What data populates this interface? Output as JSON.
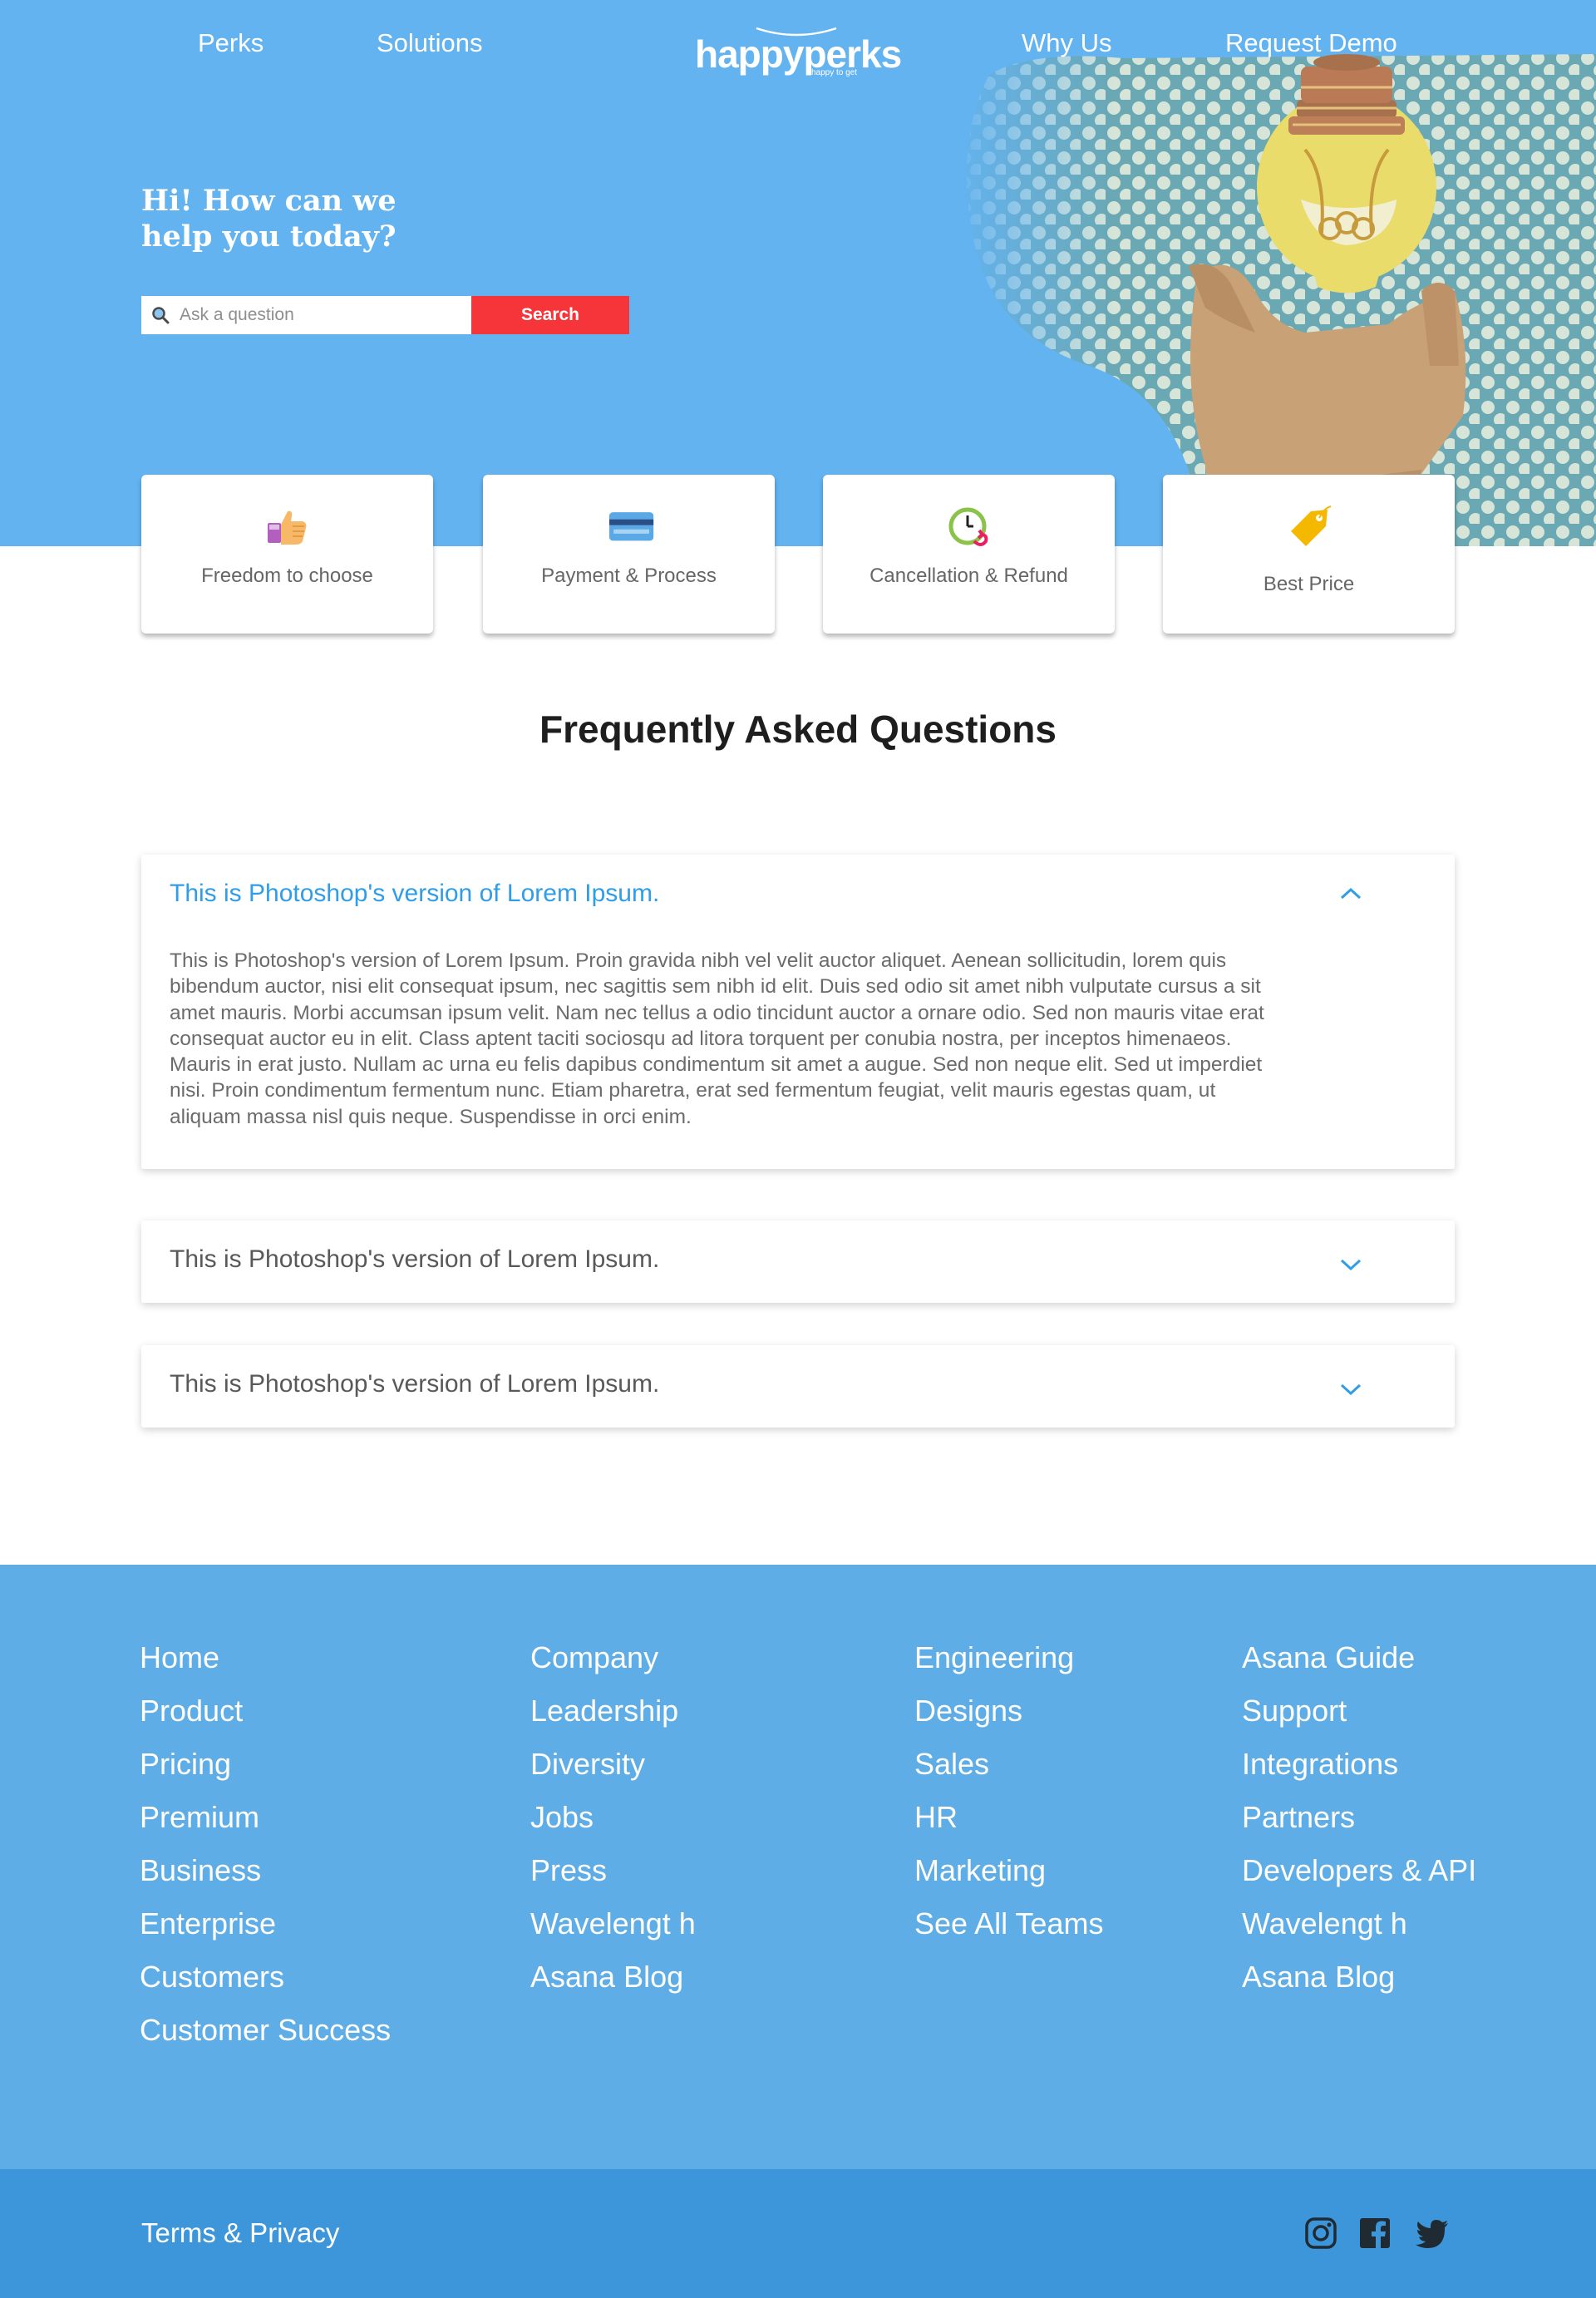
{
  "nav": {
    "links": [
      "Perks",
      "Solutions",
      "Why Us",
      "Request Demo"
    ],
    "logo_text": "happyperks",
    "logo_sub": "happy to get"
  },
  "hero": {
    "greeting": "Hi! How can we help you today?",
    "search_placeholder": "Ask a question",
    "search_button": "Search"
  },
  "categories": [
    {
      "label": "Freedom to choose",
      "icon": "thumbs-up-icon"
    },
    {
      "label": "Payment & Process",
      "icon": "credit-card-icon"
    },
    {
      "label": "Cancellation & Refund",
      "icon": "clock-refund-icon"
    },
    {
      "label": "Best Price",
      "icon": "price-tag-icon"
    }
  ],
  "faq": {
    "title": "Frequently Asked Questions",
    "items": [
      {
        "question": "This is Photoshop's version  of Lorem Ipsum.",
        "expanded": true,
        "answer": "This is Photoshop's version  of Lorem Ipsum. Proin gravida nibh vel velit auctor aliquet. Aenean sollicitudin, lorem quis bibendum auctor, nisi elit consequat ipsum, nec sagittis sem nibh id elit. Duis sed odio sit amet nibh vulputate cursus a sit amet mauris. Morbi accumsan ipsum velit. Nam nec tellus a odio tincidunt auctor a ornare odio. Sed non  mauris vitae erat consequat auctor eu in elit. Class aptent taciti sociosqu ad litora torquent per conubia nostra, per inceptos himenaeos. Mauris in erat justo. Nullam ac urna eu felis dapibus condimentum sit amet a augue. Sed non neque elit. Sed ut imperdiet nisi. Proin condimentum fermentum nunc. Etiam pharetra, erat sed fermentum feugiat, velit mauris egestas quam, ut aliquam massa nisl quis neque. Suspendisse in orci enim."
      },
      {
        "question": "This is Photoshop's version  of Lorem Ipsum.",
        "expanded": false
      },
      {
        "question": "This is Photoshop's version  of Lorem Ipsum.",
        "expanded": false
      }
    ]
  },
  "footer": {
    "columns": [
      [
        "Home",
        "Product",
        "Pricing",
        "Premium",
        "Business",
        "Enterprise",
        "Customers",
        "Customer Success"
      ],
      [
        "Company",
        "Leadership",
        "Diversity",
        "Jobs",
        "Press",
        "Wavelengt h",
        "Asana Blog"
      ],
      [
        "Engineering",
        "Designs",
        "Sales",
        "HR",
        "Marketing",
        "See All Teams"
      ],
      [
        "Asana Guide",
        "Support",
        "Integrations",
        "Partners",
        "Developers & API",
        "Wavelengt h",
        "Asana Blog"
      ]
    ],
    "terms": "Terms & Privacy",
    "social": [
      "instagram-icon",
      "facebook-icon",
      "twitter-icon"
    ]
  },
  "colors": {
    "hero_bg": "#63b3f1",
    "footer_bg": "#5eade6",
    "bottom_bar_bg": "#3c96d9",
    "search_button": "#f5353a",
    "faq_active": "#2f9de8"
  }
}
